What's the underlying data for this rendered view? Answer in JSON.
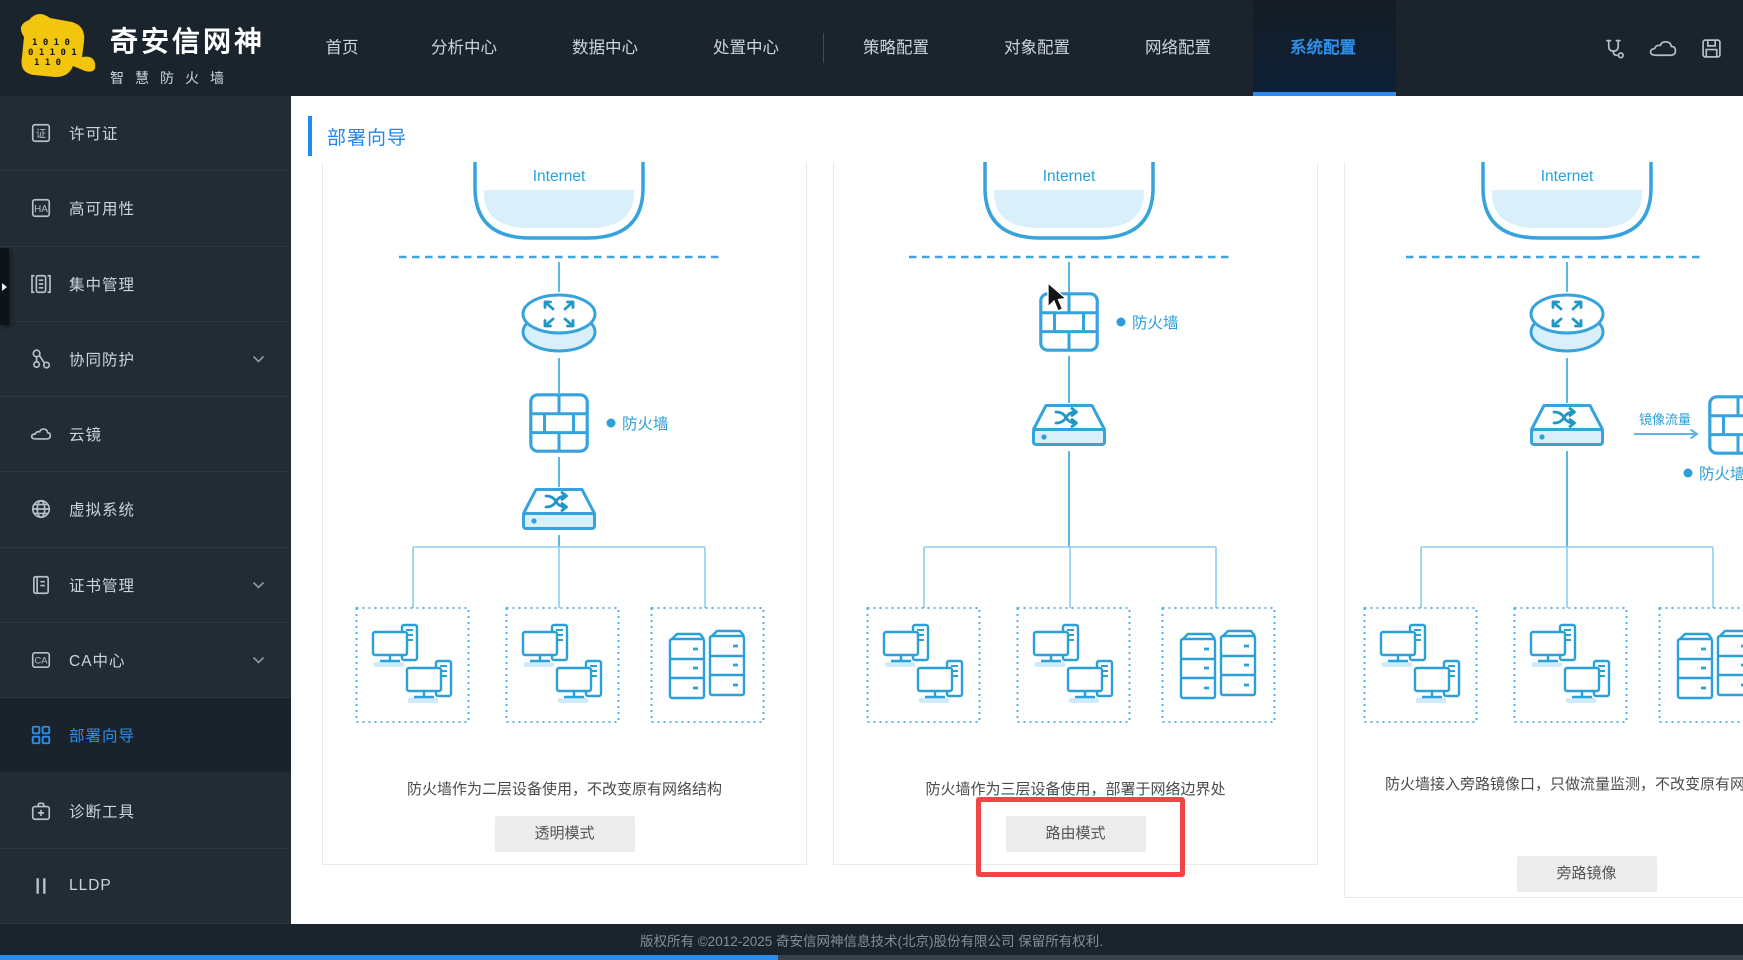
{
  "brand": {
    "title": "奇安信网神",
    "subtitle": "智慧防火墙",
    "logo": "tiger-logo"
  },
  "topnav": {
    "items": [
      {
        "label": "首页",
        "active": false
      },
      {
        "label": "分析中心",
        "active": false
      },
      {
        "label": "数据中心",
        "active": false
      },
      {
        "label": "处置中心",
        "active": false
      },
      {
        "label": "策略配置",
        "active": false
      },
      {
        "label": "对象配置",
        "active": false
      },
      {
        "label": "网络配置",
        "active": false
      },
      {
        "label": "系统配置",
        "active": true
      }
    ],
    "action_icons": [
      "stethoscope-icon",
      "cloud-icon",
      "save-icon"
    ]
  },
  "sidebar": {
    "items": [
      {
        "label": "许可证",
        "icon": "license-icon",
        "expandable": false,
        "active": false
      },
      {
        "label": "高可用性",
        "icon": "ha-icon",
        "expandable": false,
        "active": false
      },
      {
        "label": "集中管理",
        "icon": "central-manage-icon",
        "expandable": false,
        "active": false
      },
      {
        "label": "协同防护",
        "icon": "collaborate-icon",
        "expandable": true,
        "active": false
      },
      {
        "label": "云镜",
        "icon": "cloud-mirror-icon",
        "expandable": false,
        "active": false
      },
      {
        "label": "虚拟系统",
        "icon": "virtual-system-icon",
        "expandable": false,
        "active": false
      },
      {
        "label": "证书管理",
        "icon": "certificate-icon",
        "expandable": true,
        "active": false
      },
      {
        "label": "CA中心",
        "icon": "ca-icon",
        "expandable": true,
        "active": false
      },
      {
        "label": "部署向导",
        "icon": "deploy-wizard-icon",
        "expandable": false,
        "active": true
      },
      {
        "label": "诊断工具",
        "icon": "diagnostic-icon",
        "expandable": false,
        "active": false
      },
      {
        "label": "LLDP",
        "icon": "lldp-icon",
        "expandable": false,
        "active": false
      }
    ]
  },
  "page": {
    "title": "部署向导"
  },
  "deploy_modes": [
    {
      "internet_label": "Internet",
      "firewall_label": "防火墙",
      "nodes": [
        "internet",
        "router",
        "firewall",
        "switch",
        "pc-group",
        "pc-group",
        "server-group"
      ],
      "description": "防火墙作为二层设备使用，不改变原有网络结构",
      "button": "透明模式",
      "highlighted": false
    },
    {
      "internet_label": "Internet",
      "firewall_label": "防火墙",
      "nodes": [
        "internet",
        "firewall",
        "switch",
        "pc-group",
        "pc-group",
        "server-group"
      ],
      "description": "防火墙作为三层设备使用，部署于网络边界处",
      "button": "路由模式",
      "highlighted": true
    },
    {
      "internet_label": "Internet",
      "firewall_label": "防火墙",
      "mirror_label": "镜像流量",
      "nodes": [
        "internet",
        "router",
        "switch",
        "mirror-firewall",
        "pc-group",
        "pc-group",
        "server-group"
      ],
      "description": "防火墙接入旁路镜像口，只做流量监测，不改变原有网络结构",
      "button": "旁路镜像",
      "highlighted": false
    }
  ],
  "footer": {
    "copyright": "版权所有 ©2012-2025 奇安信网神信息技术(北京)股份有限公司 保留所有权利."
  },
  "colors": {
    "accent_blue": "#2d8cf0",
    "diagram_blue": "#36a3dc",
    "diagram_fill": "#d9eff9",
    "highlight_red": "#ee4545",
    "topbar_bg": "#1b242d",
    "sidebar_bg": "#222c35"
  }
}
